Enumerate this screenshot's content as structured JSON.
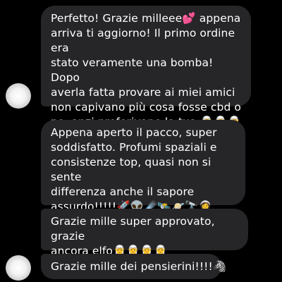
{
  "messages": [
    {
      "text": "Perfetto! Grazie milleee💕 appena\narriva ti aggiorno! Il primo ordine era\nstato veramente una bomba! Dopo\naverla fatta provare ai miei amici\nnon capivano più cosa fosse cbd o\nno, anzi preferivano la tua 🧝🧝🧝"
    },
    {
      "text": "Appena aperto il pacco, super\nsoddisfatto. Profumi spaziali e\nconsistenze top, quasi non si sente\ndifferenza anche il sapore\nassurdo!!!!!🚀👽☄️🛰️🪐🔭👩‍🚀"
    },
    {
      "text": "Grazie mille super approvato, grazie\nancora elfo🧝🧝🧝🧝"
    },
    {
      "text": "Grazie mille dei pensierini!!!!🦓"
    }
  ],
  "colors": {
    "background": "#000000",
    "bubble": "#262629",
    "text": "#ffffff"
  },
  "avatars": [
    {
      "icon": "contact-avatar-icon"
    },
    {
      "icon": "contact-avatar-icon"
    }
  ]
}
